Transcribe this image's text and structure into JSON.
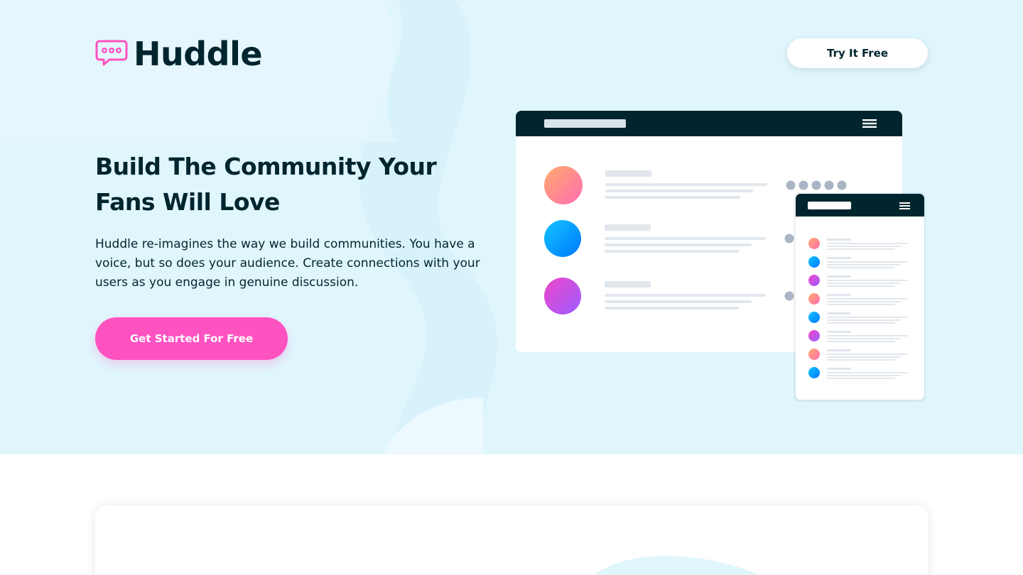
{
  "brand": {
    "name": "Huddle",
    "accent": "#ff52c1",
    "dark": "#00252e",
    "hero_bg": "#e0f6fd"
  },
  "header": {
    "try_button_label": "Try It Free"
  },
  "hero": {
    "headline": "Build The Community Your Fans Will Love",
    "description": "Huddle re-imagines the way we build communities. You have a voice, but so does your audience. Create connections with your users as you engage in genuine discussion.",
    "cta_label": "Get Started For Free"
  },
  "icons": {
    "logo": "speech-bubble-icon",
    "menu": "hamburger-menu-icon"
  }
}
